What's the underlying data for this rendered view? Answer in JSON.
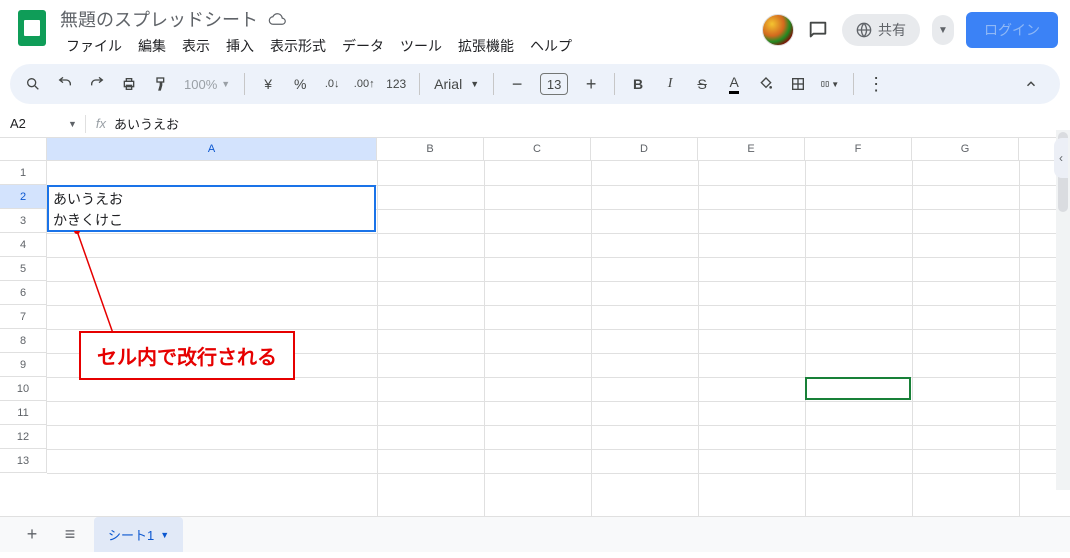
{
  "header": {
    "title": "無題のスプレッドシート",
    "menus": [
      "ファイル",
      "編集",
      "表示",
      "挿入",
      "表示形式",
      "データ",
      "ツール",
      "拡張機能",
      "ヘルプ"
    ],
    "share": "共有",
    "login": "ログイン"
  },
  "toolbar": {
    "zoom": "100%",
    "font": "Arial",
    "font_size": "13"
  },
  "formula": {
    "cell_ref": "A2",
    "fx_label": "fx",
    "value": "あいうえお"
  },
  "grid": {
    "cols": [
      "A",
      "B",
      "C",
      "D",
      "E",
      "F",
      "G"
    ],
    "rows": [
      "1",
      "2",
      "3",
      "4",
      "5",
      "6",
      "7",
      "8",
      "9",
      "10",
      "11",
      "12",
      "13"
    ],
    "a2_line1": "あいうえお",
    "a2_line2": "かきくけこ",
    "green_cell": "F10"
  },
  "annotation": {
    "text": "セル内で改行される"
  },
  "tabs": {
    "sheet1": "シート1"
  }
}
